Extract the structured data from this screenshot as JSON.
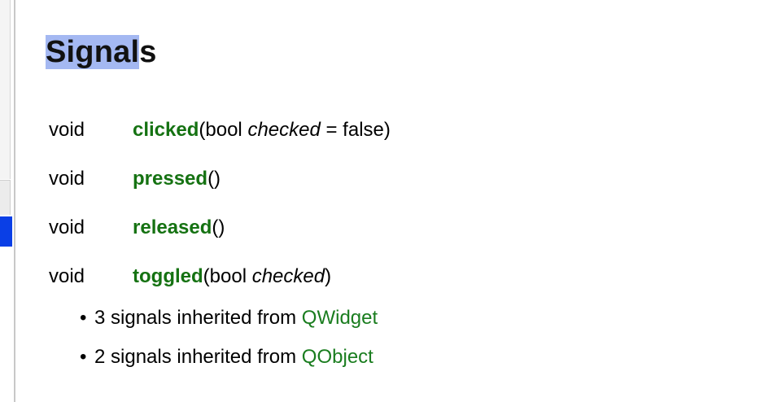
{
  "section": {
    "title_selected": "Signal",
    "title_rest": "s"
  },
  "signals": [
    {
      "type": "void",
      "name": "clicked",
      "pre": "(bool ",
      "arg": "checked",
      "post": " = false)"
    },
    {
      "type": "void",
      "name": "pressed",
      "pre": "()",
      "arg": "",
      "post": ""
    },
    {
      "type": "void",
      "name": "released",
      "pre": "()",
      "arg": "",
      "post": ""
    },
    {
      "type": "void",
      "name": "toggled",
      "pre": "(bool ",
      "arg": "checked",
      "post": ")"
    }
  ],
  "inherited": [
    {
      "bullet": "•",
      "text": "3 signals inherited from ",
      "link": "QWidget"
    },
    {
      "bullet": "•",
      "text": "2 signals inherited from ",
      "link": "QObject"
    }
  ],
  "colors": {
    "link_green": "#157212",
    "selection_highlight": "#a4b8f2",
    "sidebar_selected": "#0a3fe6"
  }
}
